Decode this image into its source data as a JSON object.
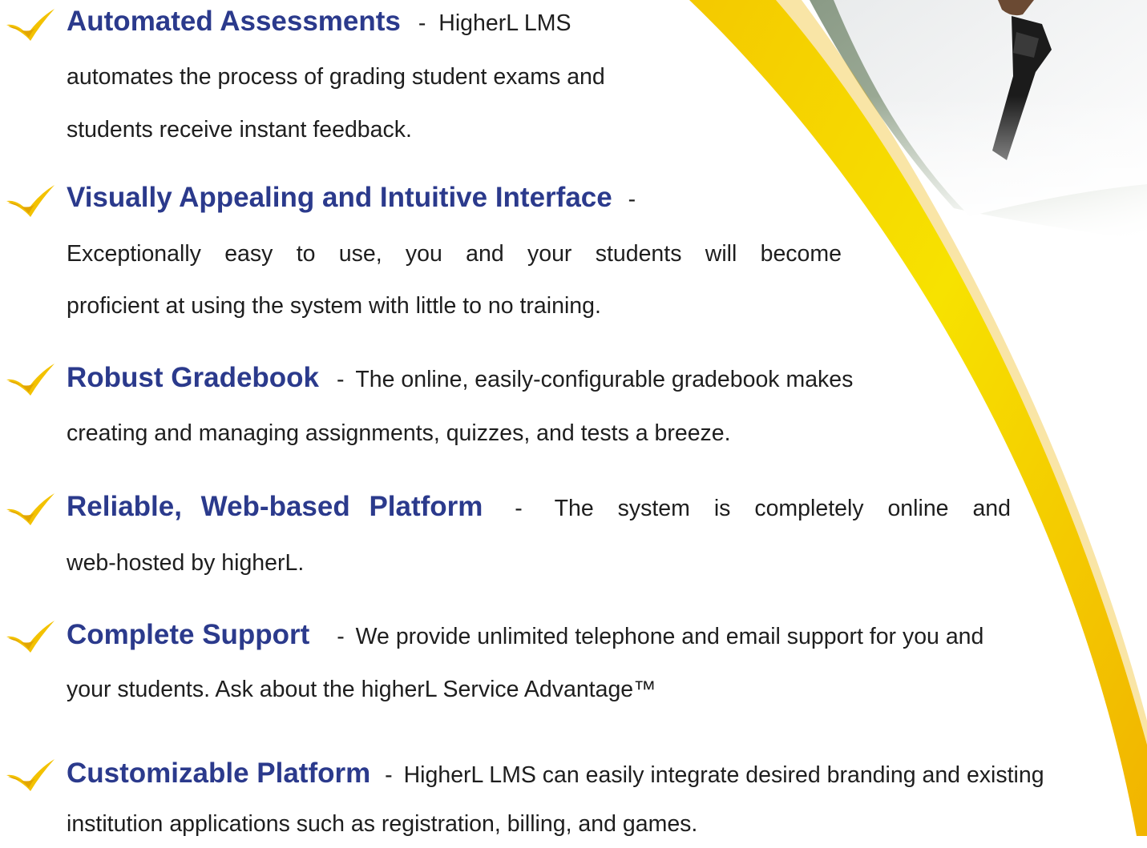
{
  "colors": {
    "title": "#2b3a8c",
    "body": "#1e1e1e",
    "swoosh_light": "#f7e400",
    "swoosh_dark": "#f1bc00",
    "check": "#f3c200"
  },
  "features": [
    {
      "icon": "check-swoosh-icon",
      "title": "Automated Assessments",
      "separator": "-",
      "lead": "HigherL LMS",
      "lines": [
        "automates the process of grading student exams and",
        "students receive instant feedback."
      ]
    },
    {
      "icon": "check-swoosh-icon",
      "title": "Visually Appealing and Intuitive Interface",
      "separator": "-",
      "lead": "",
      "lines": [
        "Exceptionally easy to use, you and your students will become",
        "proficient at using the system with little to no training."
      ]
    },
    {
      "icon": "check-swoosh-icon",
      "title": "Robust Gradebook",
      "separator": "-",
      "lead": "The online, easily-configurable gradebook makes",
      "lines": [
        "creating and managing assignments, quizzes, and tests a breeze."
      ]
    },
    {
      "icon": "check-swoosh-icon",
      "title": "Reliable, Web-based Platform",
      "separator": "-",
      "lead": "The system is completely online and",
      "lines": [
        "web-hosted by higherL."
      ]
    },
    {
      "icon": "check-swoosh-icon",
      "title": "Complete Support",
      "separator": "-",
      "lead": "We provide unlimited telephone and email support for you and",
      "lines": [
        "your students. Ask about the higherL Service Advantage™"
      ]
    },
    {
      "icon": "check-swoosh-icon",
      "title": "Customizable Platform",
      "separator": "-",
      "lead": "HigherL LMS can easily integrate desired branding and existing",
      "lines": [
        "institution applications such as registration, billing, and games."
      ]
    }
  ]
}
